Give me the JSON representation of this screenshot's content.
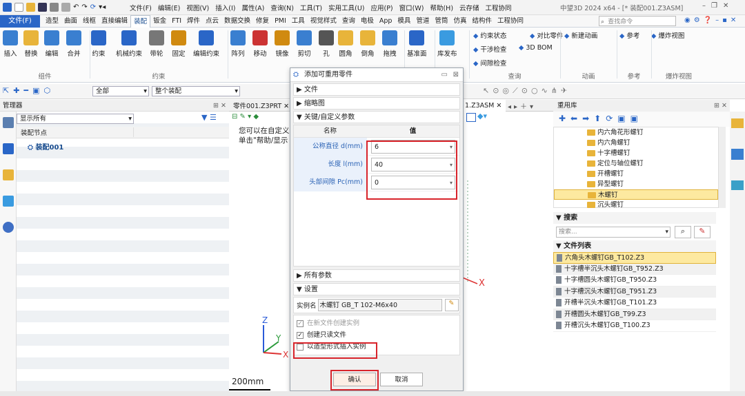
{
  "titlebar": {
    "menu": [
      "文件(F)",
      "编辑(E)",
      "视图(V)",
      "插入(I)",
      "属性(A)",
      "查询(N)",
      "工具(T)",
      "实用工具(U)",
      "应用(P)",
      "窗口(W)",
      "帮助(H)",
      "云存储",
      "工程协同"
    ],
    "title": "中望3D 2024 x64 - [* 装配001.Z3ASM]"
  },
  "tabs": {
    "file": "文件(F)",
    "items": [
      "造型",
      "曲面",
      "线框",
      "直接编辑",
      "装配",
      "钣金",
      "FTI",
      "焊件",
      "点云",
      "数据交换",
      "修复",
      "PMI",
      "工具",
      "视觉样式",
      "查询",
      "电极",
      "App",
      "模具",
      "管道",
      "管筒",
      "仿真",
      "结构件",
      "工程协同"
    ],
    "active": "装配",
    "search_placeholder": "查找命令"
  },
  "ribbon": {
    "buttons": [
      "插入",
      "替换",
      "编辑",
      "合并",
      "约束",
      "机械约束",
      "带轮",
      "固定",
      "编辑约束",
      "阵列",
      "移动",
      "镜像",
      "剪切",
      "孔",
      "圆角",
      "倒角",
      "拖拽",
      "基准面",
      "库发布"
    ],
    "small": [
      "约束状态",
      "对比零件",
      "干涉检查",
      "3D BOM",
      "间隙检查",
      "新建动画",
      "参考",
      "爆炸视图"
    ],
    "groups": [
      "组件",
      "约束",
      "查询",
      "动画",
      "参考",
      "爆炸视图"
    ]
  },
  "toolbar": {
    "filter1": "全部",
    "filter2": "整个装配"
  },
  "manager": {
    "title": "管理器",
    "filter": "显示所有",
    "col": "装配节点",
    "node": "装配001"
  },
  "doctabs": [
    "零件001.Z3PRT",
    "1.Z3ASM"
  ],
  "viewport": {
    "line1": "您可以在自定义",
    "line2": "单击\"帮助/显示",
    "axis_x": "X",
    "axis_y": "Y",
    "axis_z": "Z",
    "scale": "200mm"
  },
  "library": {
    "title": "重用库",
    "folders": [
      "内六角花形螺钉",
      "内六角螺钉",
      "十字槽螺钉",
      "定位与轴位螺钉",
      "开槽螺钉",
      "异型螺钉",
      "木螺钉",
      "沉头螺钉"
    ],
    "selected_folder": "木螺钉",
    "search_title": "搜索",
    "search_placeholder": "搜索...",
    "filelist_title": "文件列表",
    "files": [
      "六角头木螺钉GB_T102.Z3",
      "十字槽半沉头木螺钉GB_T952.Z3",
      "十字槽圆头木螺钉GB_T950.Z3",
      "十字槽沉头木螺钉GB_T951.Z3",
      "开槽半沉头木螺钉GB_T101.Z3",
      "开槽圆头木螺钉GB_T99.Z3",
      "开槽沉头木螺钉GB_T100.Z3"
    ]
  },
  "dialog": {
    "title": "添加可重用零件",
    "sec_file": "文件",
    "sec_thumb": "缩略图",
    "sec_params": "关键/自定义参数",
    "col_name": "名称",
    "col_value": "值",
    "params": [
      {
        "name": "公称直径 d(mm)",
        "value": "6"
      },
      {
        "name": "长度 l(mm)",
        "value": "40"
      },
      {
        "name": "头部间隙 Pc(mm)",
        "value": "0"
      }
    ],
    "sec_all": "所有参数",
    "sec_settings": "设置",
    "inst_label": "实例名",
    "inst_value": "木螺钉 GB_T 102-M6x40",
    "opt1": "在新文件创建实例",
    "opt2": "创建只读文件",
    "opt3": "以造型形式插入实例",
    "ok": "确认",
    "cancel": "取消"
  },
  "colors": {
    "accent": "#2a66c7",
    "highlight": "#d8232a",
    "selected_row": "#fde9a0"
  }
}
